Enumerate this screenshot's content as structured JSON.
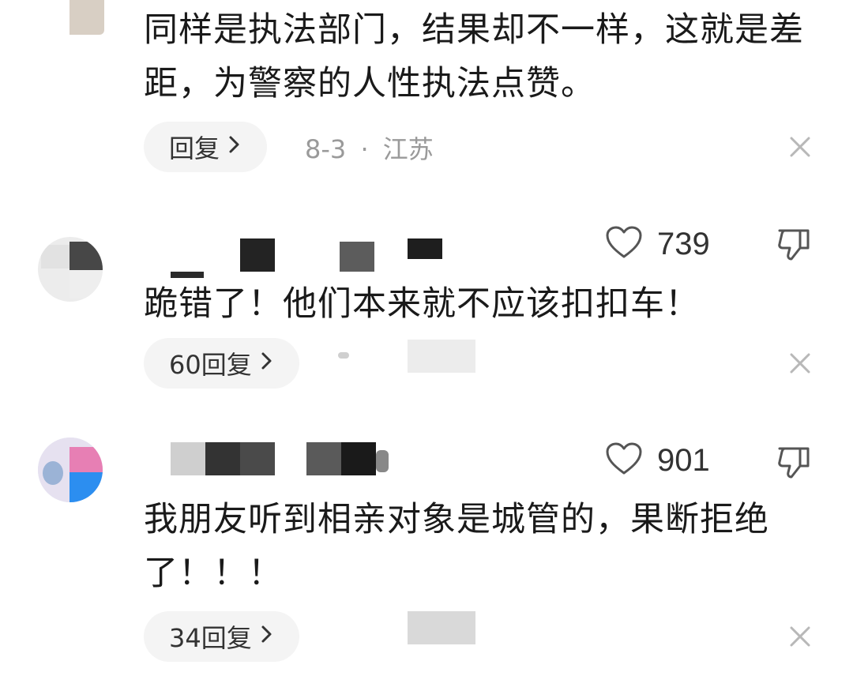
{
  "comments": [
    {
      "text": "同样是执法部门，结果却不一样，这就是差距，为警察的人性执法点赞。",
      "reply_label": "回复",
      "date": "8-3",
      "separator": "·",
      "location": "江苏"
    },
    {
      "like_count": "739",
      "text": "跪错了！他们本来就不应该扣扣车！",
      "reply_label": "60回复"
    },
    {
      "like_count": "901",
      "text": "我朋友听到相亲对象是城管的，果断拒绝了！！！",
      "reply_label": "34回复"
    }
  ],
  "icons": {
    "chevron": "chevron-right-icon",
    "close": "close-icon",
    "like": "heart-outline-icon",
    "dislike": "thumbs-down-icon"
  },
  "colors": {
    "text": "#1a1a1a",
    "meta": "#9a9a9a",
    "pill_bg": "#f4f4f4",
    "icon": "#555555",
    "close": "#b8b8b8"
  }
}
